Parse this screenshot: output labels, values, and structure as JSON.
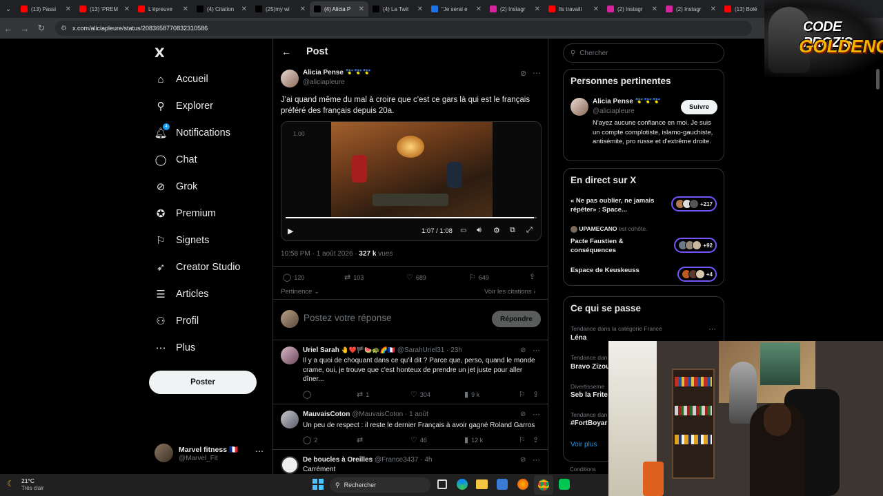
{
  "browser": {
    "tabs": [
      {
        "title": "(13) Passi",
        "icon": "youtube-icon",
        "color": "#ff0000"
      },
      {
        "title": "(13) 'PREM",
        "icon": "youtube-icon",
        "color": "#ff0000"
      },
      {
        "title": "L'épreuve",
        "icon": "youtube-icon",
        "color": "#ff0000"
      },
      {
        "title": "(4) Citation",
        "icon": "x-icon",
        "color": "#000000"
      },
      {
        "title": "(25)my wi",
        "icon": "tiktok-icon",
        "color": "#000000"
      },
      {
        "title": "(4) Alicia P",
        "icon": "x-icon",
        "color": "#000000",
        "active": true
      },
      {
        "title": "(4) La Twit",
        "icon": "x-icon",
        "color": "#000000"
      },
      {
        "title": "\"Je serai e",
        "icon": "dot-icon",
        "color": "#1a73e8"
      },
      {
        "title": "(2) Instagr",
        "icon": "instagram-icon",
        "color": "#d6249f"
      },
      {
        "title": "Ils travaill",
        "icon": "youtube-icon",
        "color": "#ff0000"
      },
      {
        "title": "(2) Instagr",
        "icon": "instagram-icon",
        "color": "#d6249f"
      },
      {
        "title": "(2) Instagr",
        "icon": "instagram-icon",
        "color": "#d6249f"
      },
      {
        "title": "(13) Bolé",
        "icon": "youtube-icon",
        "color": "#ff0000"
      }
    ],
    "url": "x.com/aliciapleure/status/2083658770832310586"
  },
  "nav": {
    "logo": "X",
    "items": [
      {
        "label": "Accueil",
        "icon": "home-icon",
        "glyph": "⌂"
      },
      {
        "label": "Explorer",
        "icon": "search-icon",
        "glyph": "⚲"
      },
      {
        "label": "Notifications",
        "icon": "bell-icon",
        "glyph": "🔔︎",
        "badge": "4"
      },
      {
        "label": "Chat",
        "icon": "chat-icon",
        "glyph": "◯"
      },
      {
        "label": "Grok",
        "icon": "grok-icon",
        "glyph": "⊘"
      },
      {
        "label": "Premium",
        "icon": "verified-icon",
        "glyph": "✪"
      },
      {
        "label": "Signets",
        "icon": "bookmark-icon",
        "glyph": "⚐"
      },
      {
        "label": "Creator Studio",
        "icon": "rocket-icon",
        "glyph": "➶"
      },
      {
        "label": "Articles",
        "icon": "article-icon",
        "glyph": "☰"
      },
      {
        "label": "Profil",
        "icon": "profile-icon",
        "glyph": "⚇"
      },
      {
        "label": "Plus",
        "icon": "more-icon",
        "glyph": "⋯"
      }
    ],
    "post_button": "Poster",
    "account": {
      "name": "Marvel fitness 🇫🇷",
      "handle": "@Marvel_Fit"
    }
  },
  "post": {
    "header": "Post",
    "author": {
      "name": "Alicia Pense 🇬🇵🇬🇵🇬🇵",
      "handle": "@aliciapleure"
    },
    "text": "J'ai quand même du mal à croire que c'est ce gars là qui est le français préféré des français depuis 20a.",
    "video": {
      "speed": "1.00",
      "time": "1:07 / 1:08",
      "progress": 0.99
    },
    "time": "10:58 PM · 1 août 2026 · ",
    "views": "327 k",
    "views_label": " vues",
    "stats": {
      "replies": "120",
      "reposts": "103",
      "likes": "689",
      "bookmarks": "649"
    },
    "sort": "Pertinence",
    "quotes_link": "Voir les citations",
    "reply_placeholder": "Postez votre réponse",
    "reply_button": "Répondre"
  },
  "replies": [
    {
      "name": "Uriel Sarah",
      "handle": "@SarahUriel31 · 23h",
      "text": "Il y a quoi de choquant dans ce qu'il dit ? Parce que, perso, quand le monde crame, oui, je trouve que c'est honteux de prendre un jet juste pour aller dîner...",
      "reposts": "1",
      "likes": "304",
      "views": "9 k"
    },
    {
      "name": "MauvaisCoton",
      "handle": "@MauvaisCoton · 1 août",
      "text": "Un peu de respect : il reste le dernier Français à avoir gagné Roland Garros",
      "replies": "2",
      "likes": "46",
      "views": "12 k"
    },
    {
      "name": "De boucles à Oreilles",
      "handle": "@France3437 · 4h",
      "text": "Carrément"
    }
  ],
  "right": {
    "search_placeholder": "Chercher",
    "people": {
      "title": "Personnes pertinentes",
      "name": "Alicia Pense 🇬🇵🇬🇵🇬🇵",
      "handle": "@aliciapleure",
      "follow": "Suivre",
      "bio": "N'ayez aucune confiance en moi. Je suis un compte complotiste, islamo-gauchiste, antisémite, pro russe et d'extrême droite."
    },
    "live": {
      "title": "En direct sur X",
      "spaces": [
        {
          "title": "« Ne pas oublier, ne jamais répéter» : Space...",
          "count": "+217"
        },
        {
          "host": "UPAMECANO",
          "host_suffix": " est cohôte.",
          "title": "Pacte Faustien & conséquences",
          "count": "+92"
        },
        {
          "title": "Espace de Keuskeuss",
          "count": "+4"
        }
      ]
    },
    "trends": {
      "title": "Ce qui se passe",
      "items": [
        {
          "context": "Tendance dans la catégorie France",
          "name": "Léna"
        },
        {
          "context": "Tendance dan",
          "name": "Bravo Zizou"
        },
        {
          "context": "Divertisseme",
          "name": "Seb la Frite"
        },
        {
          "context": "Tendance dan",
          "name": "#FortBoyar"
        }
      ],
      "more": "Voir plus"
    },
    "footer": "Conditions"
  },
  "overlay": {
    "line1": "CODE PROZIS",
    "line2": "GOLDENG"
  },
  "taskbar": {
    "temp": "21°C",
    "weather": "Très clair",
    "search": "Rechercher"
  }
}
